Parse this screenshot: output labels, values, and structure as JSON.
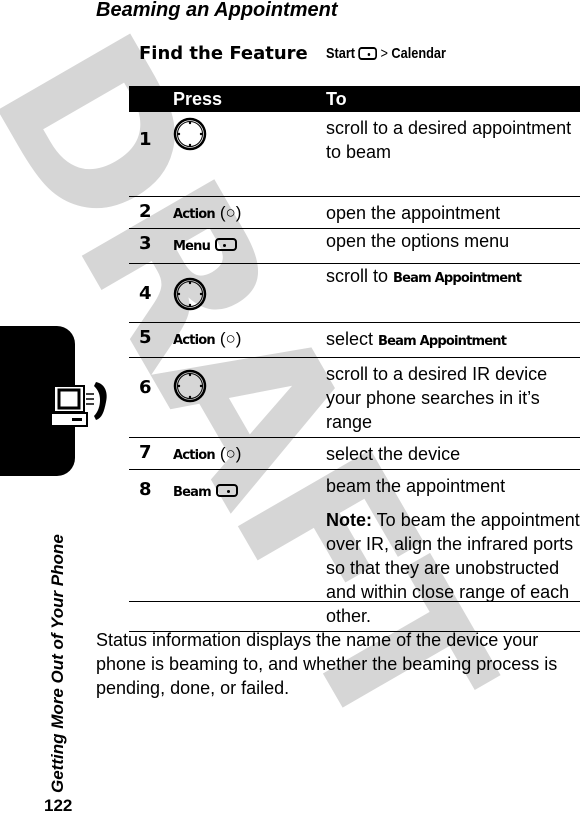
{
  "watermark": "DRAFT",
  "section": {
    "side_title": "Getting More Out of Your Phone",
    "page_number": "122",
    "tab_icon": "computer-phone-icon"
  },
  "heading": "Beaming an Appointment",
  "find_the_feature": {
    "label": "Find the Feature",
    "path_start": "Start",
    "path_icon": "right-softkey-icon",
    "separator": ">",
    "path_end": "Calendar"
  },
  "table": {
    "headers": {
      "press": "Press",
      "to": "To"
    },
    "rows": [
      {
        "num": "1",
        "press_icon": "navigation-key-icon",
        "to": "scroll to a desired appointment to beam"
      },
      {
        "num": "2",
        "press_label": "Action",
        "press_paren": "(○)",
        "to": "open the appointment"
      },
      {
        "num": "3",
        "press_label": "Menu",
        "press_icon": "left-softkey-icon",
        "to": "open the options menu"
      },
      {
        "num": "4",
        "press_icon": "navigation-key-icon",
        "to_prefix": "scroll to ",
        "to_bold": "Beam Appointment"
      },
      {
        "num": "5",
        "press_label": "Action",
        "press_paren": "(○)",
        "to_prefix": "select ",
        "to_bold": "Beam Appointment"
      },
      {
        "num": "6",
        "press_icon": "navigation-key-icon",
        "to": "scroll to a desired IR device your phone searches in it’s range"
      },
      {
        "num": "7",
        "press_label": "Action",
        "press_paren": "(○)",
        "to": "select the device"
      },
      {
        "num": "8",
        "press_label": "Beam",
        "press_icon": "right-softkey-icon",
        "to": "beam the appointment",
        "note_label": "Note:",
        "note_text": " To beam the appointment over IR, align the infrared ports so that they are unobstructed and within close range of each other."
      }
    ]
  },
  "status_paragraph": "Status information displays the name of the device your phone is beaming to, and whether the beaming process is pending, done, or failed."
}
